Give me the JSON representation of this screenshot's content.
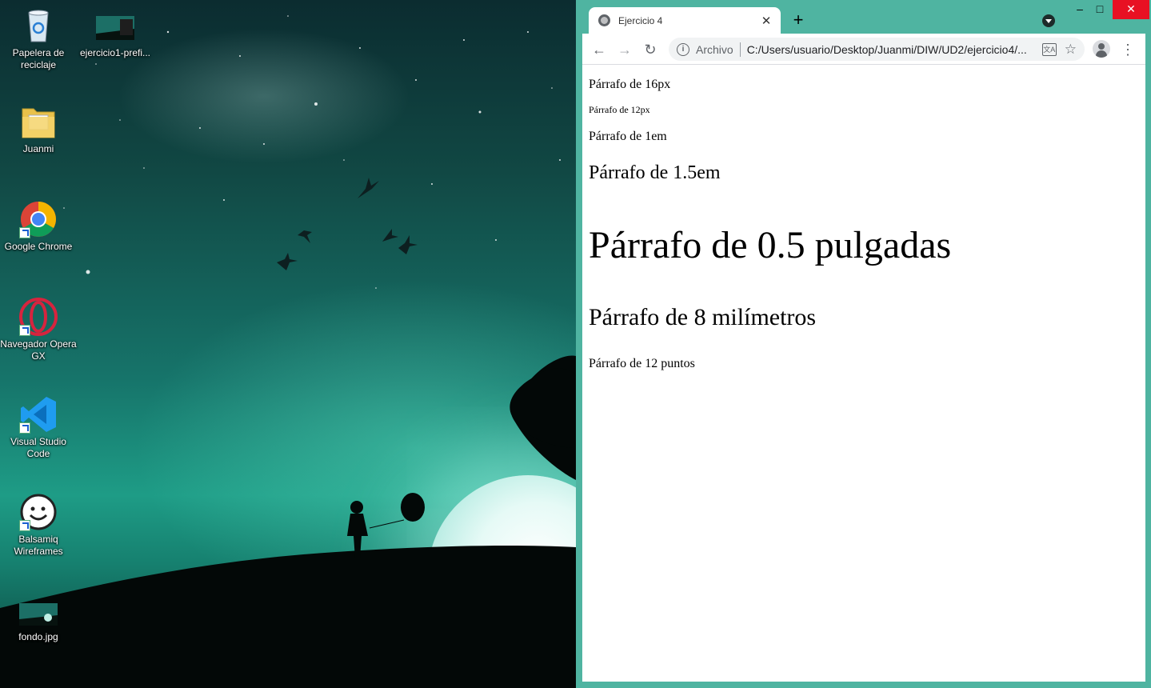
{
  "desktop": {
    "icons": [
      {
        "label": "Papelera de reciclaje",
        "icon": "recycle-bin-icon"
      },
      {
        "label": "ejercicio1-prefi...",
        "icon": "image-file-icon"
      },
      {
        "label": "Juanmi",
        "icon": "folder-icon"
      },
      {
        "label": "Google Chrome",
        "icon": "chrome-icon"
      },
      {
        "label": "Navegador Opera GX",
        "icon": "opera-gx-icon"
      },
      {
        "label": "Visual Studio Code",
        "icon": "vscode-icon"
      },
      {
        "label": "Balsamiq Wireframes",
        "icon": "balsamiq-icon"
      },
      {
        "label": "fondo.jpg",
        "icon": "image-file-icon"
      }
    ]
  },
  "browser": {
    "tab": {
      "title": "Ejercicio 4",
      "close": "✕"
    },
    "new_tab": "+",
    "window_controls": {
      "minimize": "–",
      "maximize": "□",
      "close": "✕"
    },
    "nav": {
      "back": "←",
      "forward": "→",
      "reload": "↻"
    },
    "address": {
      "info": "i",
      "scheme_label": "Archivo",
      "url": "C:/Users/usuario/Desktop/Juanmi/DIW/UD2/ejercicio4/..."
    },
    "star": "☆",
    "menu": "⋮"
  },
  "page": {
    "paragraphs": [
      {
        "text": "Párrafo de 16px"
      },
      {
        "text": "Párrafo de 12px"
      },
      {
        "text": "Párrafo de 1em"
      },
      {
        "text": "Párrafo de 1.5em"
      },
      {
        "text": "Párrafo de 0.5 pulgadas"
      },
      {
        "text": "Párrafo de 8 milímetros"
      },
      {
        "text": "Párrafo de 12 puntos"
      }
    ]
  },
  "colors": {
    "accent": "#4fb4a1",
    "close_red": "#e81123"
  }
}
